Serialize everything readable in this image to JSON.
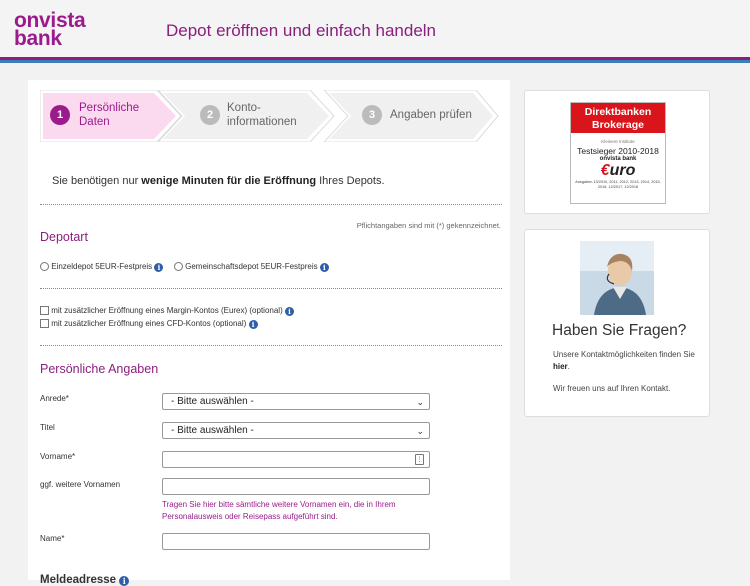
{
  "header": {
    "logo_line1": "onvista",
    "logo_line2": "bank",
    "title": "Depot eröffnen und einfach handeln"
  },
  "steps": [
    {
      "num": "1",
      "line1": "Persönliche",
      "line2": "Daten",
      "active": true
    },
    {
      "num": "2",
      "line1": "Konto-",
      "line2": "informationen",
      "active": false
    },
    {
      "num": "3",
      "line1": "Angaben prüfen",
      "line2": "",
      "active": false
    }
  ],
  "intro": {
    "pre": "Sie benötigen nur ",
    "bold": "wenige Minuten für die Eröffnung",
    "post": " Ihres Depots."
  },
  "required_note": "Pflichtangaben sind mit (*) gekennzeichnet.",
  "depotart": {
    "title": "Depotart",
    "option1": "Einzeldepot 5EUR-Festpreis",
    "option2": "Gemeinschaftsdepot 5EUR-Festpreis"
  },
  "extras": {
    "margin": "mit zusätzlicher Eröffnung eines Margin-Kontos (Eurex) (optional)",
    "cfd": "mit zusätzlicher Eröffnung eines CFD-Kontos (optional)"
  },
  "personal": {
    "title": "Persönliche Angaben",
    "anrede_label": "Anrede*",
    "anrede_value": "- Bitte auswählen -",
    "titel_label": "Titel",
    "titel_value": "- Bitte auswählen -",
    "vorname_label": "Vorname*",
    "weitere_label": "ggf. weitere Vornamen",
    "weitere_hint": "Tragen Sie hier bitte sämtliche weitere Vornamen ein, die in Ihrem Personalausweis oder Reisepass aufgeführt sind.",
    "name_label": "Name*"
  },
  "meldeadresse": "Meldeadresse",
  "badge": {
    "top": "Direktbanken Brokerage",
    "kleine": "Kleinere Institute",
    "test": "Testsieger 2010-2018",
    "bank": "onvista bank",
    "euro_c": "€",
    "euro_rest": "uro",
    "small": "Ausgaben 13/2010, 2011, 2012, 2013, 2014, 2015, 2016, 12/2017, 12/2018"
  },
  "contact": {
    "title": "Haben Sie Fragen?",
    "text_pre": "Unsere Kontaktmöglichkeiten finden Sie ",
    "text_link": "hier",
    "text_post": ".",
    "text2": "Wir freuen uns auf Ihren Kontakt."
  },
  "icons": {
    "info": "info-icon",
    "dropdown": "chevron-down-icon",
    "contact_card": "contact-card-icon"
  },
  "colors": {
    "brand": "#8b1e7e",
    "info": "#2d5ea8",
    "badge_red": "#d9141a"
  }
}
